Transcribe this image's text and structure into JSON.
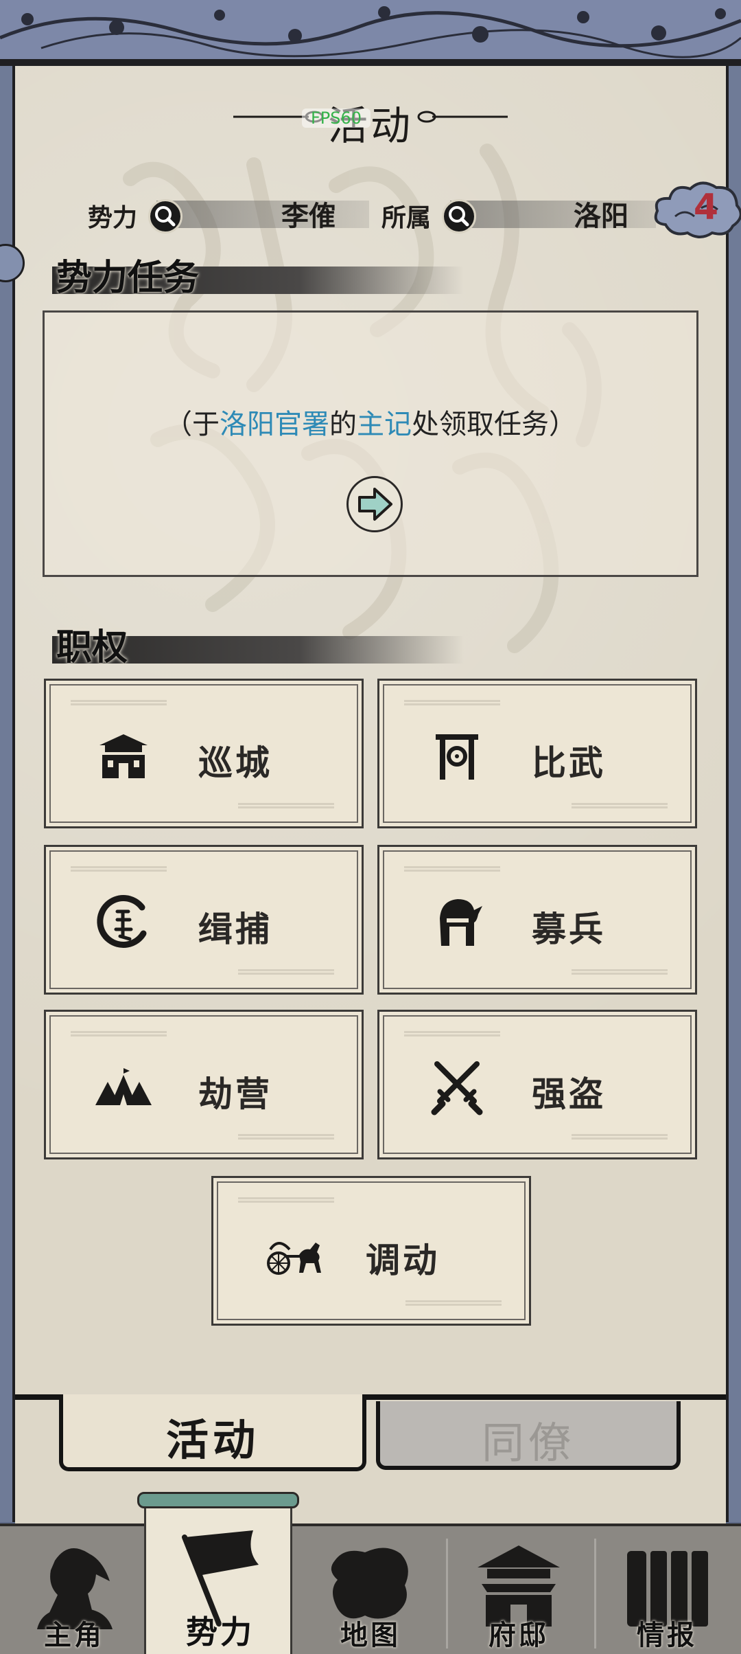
{
  "header": {
    "title": "活动",
    "fps": "FPS60"
  },
  "info": {
    "faction_label": "势力",
    "faction_value": "李傕",
    "location_label": "所属",
    "location_value": "洛阳",
    "badge_count": "4"
  },
  "task_section": {
    "title": "势力任务",
    "prefix": "（于",
    "place": "洛阳官署",
    "mid": "的",
    "person": "主记",
    "suffix": "处领取任务）"
  },
  "duty_section": {
    "title": "职权",
    "items": [
      {
        "label": "巡城",
        "icon": "city-gate-icon"
      },
      {
        "label": "比武",
        "icon": "arena-gate-icon"
      },
      {
        "label": "缉捕",
        "icon": "arrest-seal-icon"
      },
      {
        "label": "募兵",
        "icon": "soldier-helmet-icon"
      },
      {
        "label": "劫营",
        "icon": "camp-tents-icon"
      },
      {
        "label": "强盗",
        "icon": "crossed-swords-icon"
      },
      {
        "label": "调动",
        "icon": "chariot-icon"
      }
    ]
  },
  "tabs": {
    "active": "活动",
    "inactive": "同僚"
  },
  "nav": {
    "items": [
      {
        "label": "主角",
        "icon": "hero-portrait-icon"
      },
      {
        "label": "势力",
        "icon": "banner-flag-icon"
      },
      {
        "label": "地图",
        "icon": "map-icon"
      },
      {
        "label": "府邸",
        "icon": "mansion-icon"
      },
      {
        "label": "情报",
        "icon": "scrolls-icon"
      }
    ],
    "active_index": 1
  },
  "colors": {
    "paper": "#ddd7c8",
    "frame": "#6f7b97",
    "highlight_text": "#2e8ab6",
    "badge_text": "#b0303b",
    "fps_text": "#35b24a"
  }
}
